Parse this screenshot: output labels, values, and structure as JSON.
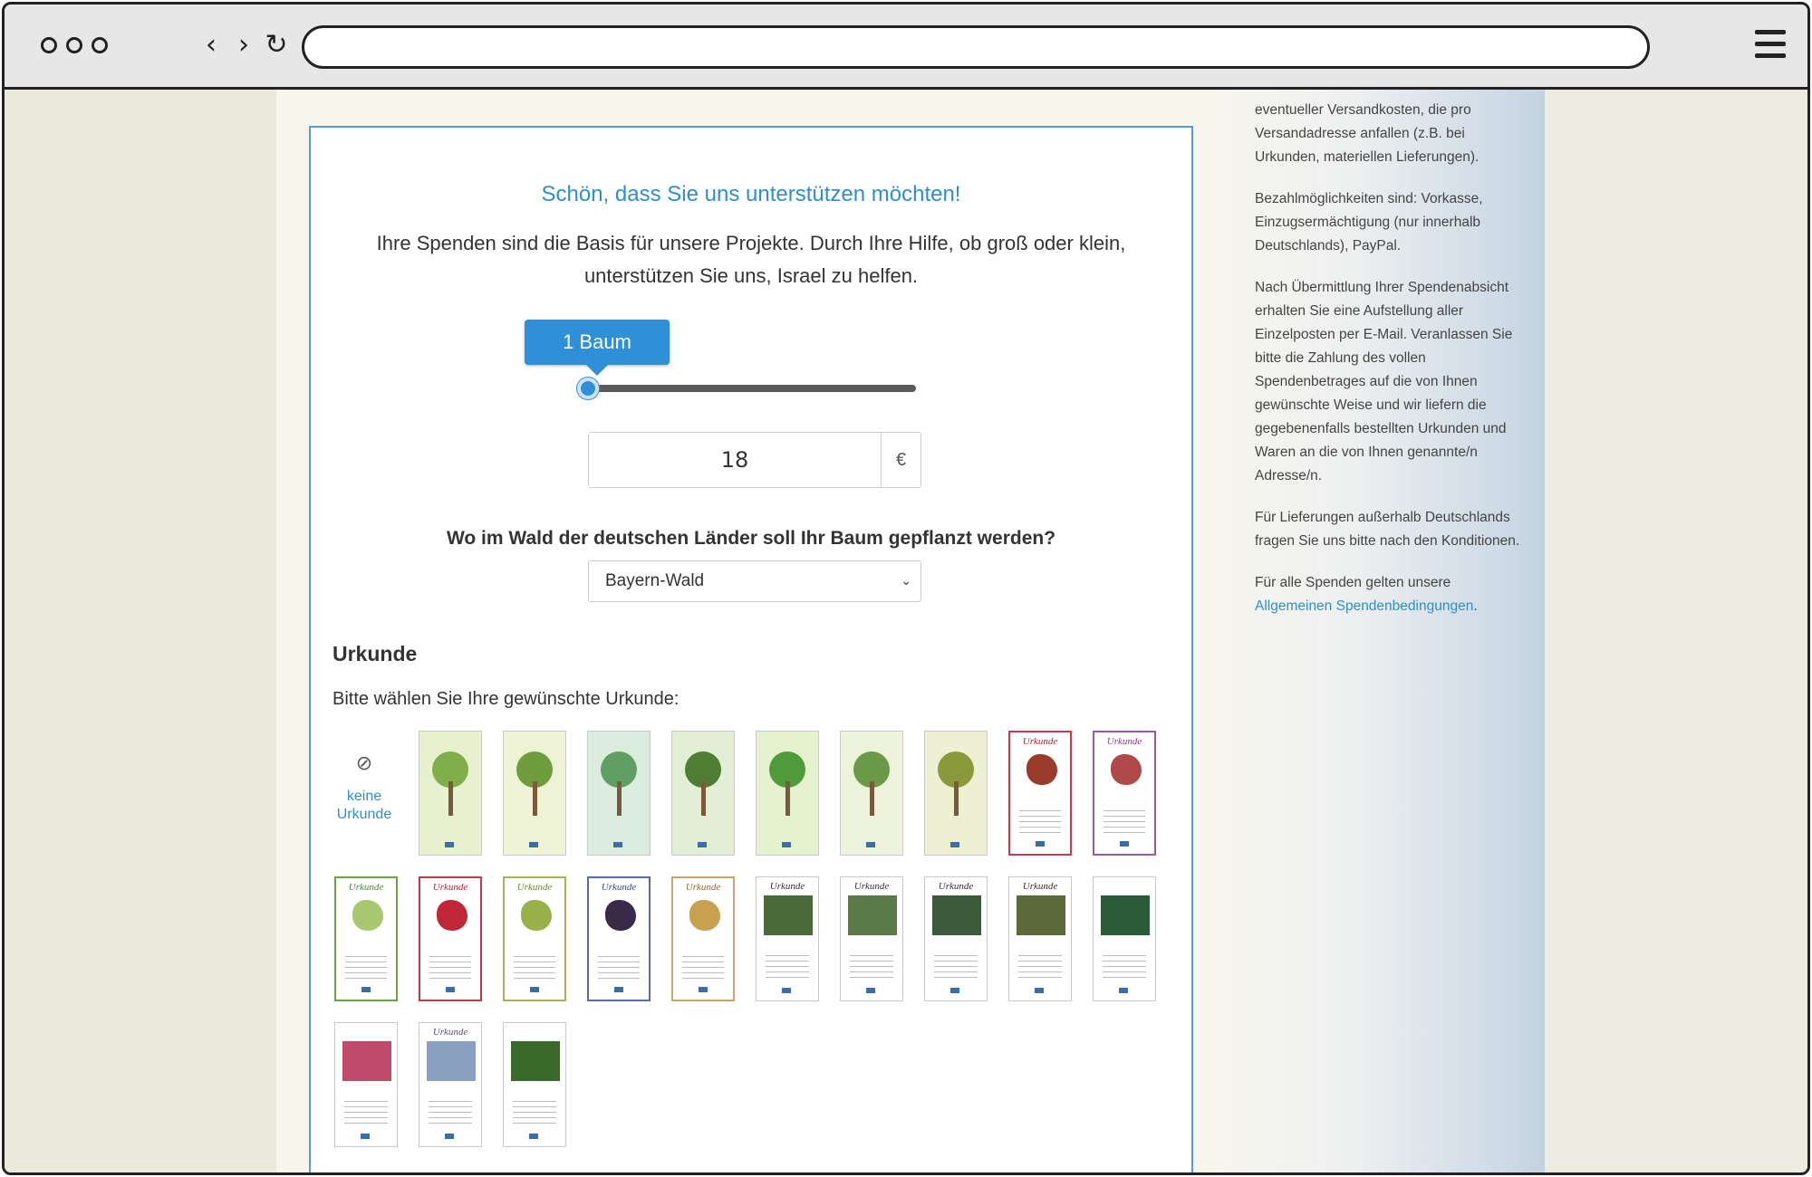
{
  "browser": {
    "address": "",
    "nav_back": "‹",
    "nav_forward": "›",
    "nav_reload": "↻"
  },
  "donation": {
    "heading": "Schön, dass Sie uns unterstützen möchten!",
    "intro": "Ihre Spenden sind die Basis für unsere Projekte. Durch Ihre Hilfe, ob groß oder klein, unterstützen Sie uns, Israel zu helfen.",
    "slider_label": "1 Baum",
    "slider_value": 0,
    "amount": "18",
    "currency": "€",
    "forest_question": "Wo im Wald der deutschen Länder soll Ihr Baum gepflanzt werden?",
    "forest_selected": "Bayern-Wald"
  },
  "certificate": {
    "heading": "Urkunde",
    "hint": "Bitte wählen Sie Ihre gewünschte Urkunde:",
    "none_label": "keine Urkunde",
    "items": [
      {
        "kind": "none"
      },
      {
        "kind": "tree",
        "bg": "#e8f0d0",
        "foliage": "#7fae4a"
      },
      {
        "kind": "tree",
        "bg": "#eef3d6",
        "foliage": "#6f9d3d"
      },
      {
        "kind": "tree",
        "bg": "#dcecdf",
        "foliage": "#5f9f62"
      },
      {
        "kind": "tree",
        "bg": "#e3efd5",
        "foliage": "#4e7d33"
      },
      {
        "kind": "tree",
        "bg": "#e6f1cf",
        "foliage": "#4f9a3a"
      },
      {
        "kind": "tree",
        "bg": "#edf2da",
        "foliage": "#6a9a47"
      },
      {
        "kind": "tree",
        "bg": "#eef0d4",
        "foliage": "#8a9a3a"
      },
      {
        "kind": "fruit",
        "title": "Urkunde",
        "title_color": "#b0283a",
        "fruit": "#9a3a2a",
        "frame": "#c33a4a"
      },
      {
        "kind": "fruit",
        "title": "Urkunde",
        "title_color": "#8a3a8a",
        "fruit": "#b04a4a",
        "frame": "#9a5aa8"
      },
      {
        "kind": "fruit",
        "title": "Urkunde",
        "title_color": "#4a8a3a",
        "fruit": "#a8c870",
        "frame": "#6aa04a"
      },
      {
        "kind": "fruit",
        "title": "Urkunde",
        "title_color": "#b0283a",
        "fruit": "#c0283a",
        "frame": "#c33a4a"
      },
      {
        "kind": "fruit",
        "title": "Urkunde",
        "title_color": "#6a8a2a",
        "fruit": "#9ab04a",
        "frame": "#a8b060"
      },
      {
        "kind": "fruit",
        "title": "Urkunde",
        "title_color": "#3a4a8a",
        "fruit": "#3a2a4a",
        "frame": "#5a6aa8"
      },
      {
        "kind": "fruit",
        "title": "Urkunde",
        "title_color": "#8a6a2a",
        "fruit": "#c8a050",
        "frame": "#c8a870"
      },
      {
        "kind": "photo",
        "title": "Urkunde",
        "title_color": "#333",
        "photo": "#4a6a3a"
      },
      {
        "kind": "photo",
        "title": "Urkunde",
        "title_color": "#333",
        "photo": "#5a7a4a"
      },
      {
        "kind": "photo",
        "title": "Urkunde",
        "title_color": "#333",
        "photo": "#3a5a3a"
      },
      {
        "kind": "photo",
        "title": "Urkunde",
        "title_color": "#333",
        "photo": "#5a6a3a"
      },
      {
        "kind": "photo",
        "title": "",
        "title_color": "#333",
        "photo": "#2a5a3a"
      },
      {
        "kind": "photo",
        "title": "",
        "title_color": "#333",
        "photo": "#c04a6a"
      },
      {
        "kind": "photo",
        "title": "Urkunde",
        "title_color": "#556",
        "photo": "#8aa0c0"
      },
      {
        "kind": "photo",
        "title": "",
        "title_color": "#333",
        "photo": "#3a6a2a"
      }
    ]
  },
  "sidebar": {
    "p1": "eventueller Versandkosten, die pro Versandadresse anfallen (z.B. bei Urkunden, materiellen Lieferungen).",
    "p2": "Bezahlmöglichkeiten sind: Vorkasse, Einzugsermächtigung (nur innerhalb Deutschlands), PayPal.",
    "p3": "Nach Übermittlung Ihrer Spendenabsicht erhalten Sie eine Aufstellung aller Einzelposten per E-Mail. Veranlassen Sie bitte die Zahlung des vollen Spendenbetrages auf die von Ihnen gewünschte Weise und wir liefern die gegebenenfalls bestellten Urkunden und Waren an die von Ihnen genannte/n Adresse/n.",
    "p4": "Für Lieferungen außerhalb Deutschlands fragen Sie uns bitte nach den Konditionen.",
    "p5_prefix": "Für alle Spenden gelten unsere ",
    "p5_link": "Allgemeinen Spendenbedingungen",
    "p5_suffix": "."
  }
}
